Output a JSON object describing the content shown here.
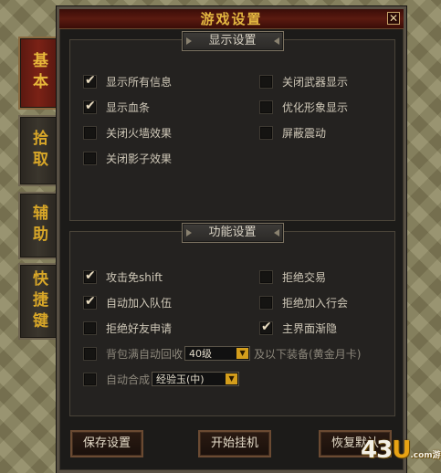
{
  "window": {
    "title": "游戏设置",
    "close_symbol": "✕"
  },
  "side_tabs": [
    {
      "label": "基本",
      "active": true
    },
    {
      "label": "拾取",
      "active": false
    },
    {
      "label": "辅助",
      "active": false
    },
    {
      "label": "快捷键",
      "active": false
    }
  ],
  "display_section": {
    "title": "显示设置",
    "options": [
      {
        "label": "显示所有信息",
        "checked": true
      },
      {
        "label": "关闭武器显示",
        "checked": false
      },
      {
        "label": "显示血条",
        "checked": true
      },
      {
        "label": "优化形象显示",
        "checked": false
      },
      {
        "label": "关闭火墙效果",
        "checked": false
      },
      {
        "label": "屏蔽震动",
        "checked": false
      },
      {
        "label": "关闭影子效果",
        "checked": false
      }
    ]
  },
  "function_section": {
    "title": "功能设置",
    "options": [
      {
        "label": "攻击免shift",
        "checked": true
      },
      {
        "label": "拒绝交易",
        "checked": false
      },
      {
        "label": "自动加入队伍",
        "checked": true
      },
      {
        "label": "拒绝加入行会",
        "checked": false
      },
      {
        "label": "拒绝好友申请",
        "checked": false
      },
      {
        "label": "主界面渐隐",
        "checked": true
      }
    ],
    "auto_recycle": {
      "label": "背包满自动回收",
      "select_value": "40级",
      "suffix": "及以下装备(黄金月卡)",
      "checked": false
    },
    "auto_combine": {
      "label": "自动合成",
      "select_value": "经验玉(中)",
      "checked": false
    }
  },
  "buttons": {
    "save": "保存设置",
    "start": "开始挂机",
    "restore": "恢复默认"
  },
  "watermark": {
    "num": "43",
    "accent": "U",
    "domain": ".com",
    "suffix": "游戏"
  },
  "colors": {
    "title_gold": "#e2b640",
    "tab_gold": "#d7a628",
    "select_arrow": "#d49e1c"
  }
}
